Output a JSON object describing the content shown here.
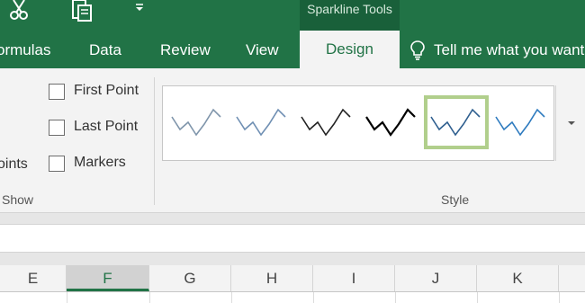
{
  "quick_access": {
    "icons": [
      "scissors-icon",
      "clipboard-icon",
      "customize-quick-access-icon"
    ]
  },
  "contextual_group": {
    "label": "Sparkline Tools"
  },
  "tabs": [
    {
      "label": "ormulas",
      "active": false
    },
    {
      "label": "Data",
      "active": false
    },
    {
      "label": "Review",
      "active": false
    },
    {
      "label": "View",
      "active": false
    },
    {
      "label": "Design",
      "active": true
    }
  ],
  "tell_me": {
    "icon": "lightbulb-icon",
    "text": "Tell me what you want"
  },
  "show_group": {
    "cut_label": "oints",
    "checkboxes": [
      {
        "label": "First Point",
        "checked": false
      },
      {
        "label": "Last Point",
        "checked": false
      },
      {
        "label": "Markers",
        "checked": false
      }
    ],
    "group_label": "Show"
  },
  "style_group": {
    "group_label": "Style",
    "styles": [
      {
        "color": "#7f95ab",
        "selected": false
      },
      {
        "color": "#6f8fb3",
        "selected": false
      },
      {
        "color": "#222222",
        "selected": false
      },
      {
        "color": "#000000",
        "selected": false
      },
      {
        "color": "#2f5f8f",
        "selected": true
      },
      {
        "color": "#2e7bbf",
        "selected": false
      }
    ],
    "more_icon": "dropdown-arrow-icon"
  },
  "columns": [
    {
      "label": "E",
      "active": false
    },
    {
      "label": "F",
      "active": true
    },
    {
      "label": "G",
      "active": false
    },
    {
      "label": "H",
      "active": false
    },
    {
      "label": "I",
      "active": false
    },
    {
      "label": "J",
      "active": false
    },
    {
      "label": "K",
      "active": false
    }
  ],
  "colors": {
    "brand_green": "#217346",
    "selected_style_border": "#b1cf8c"
  }
}
